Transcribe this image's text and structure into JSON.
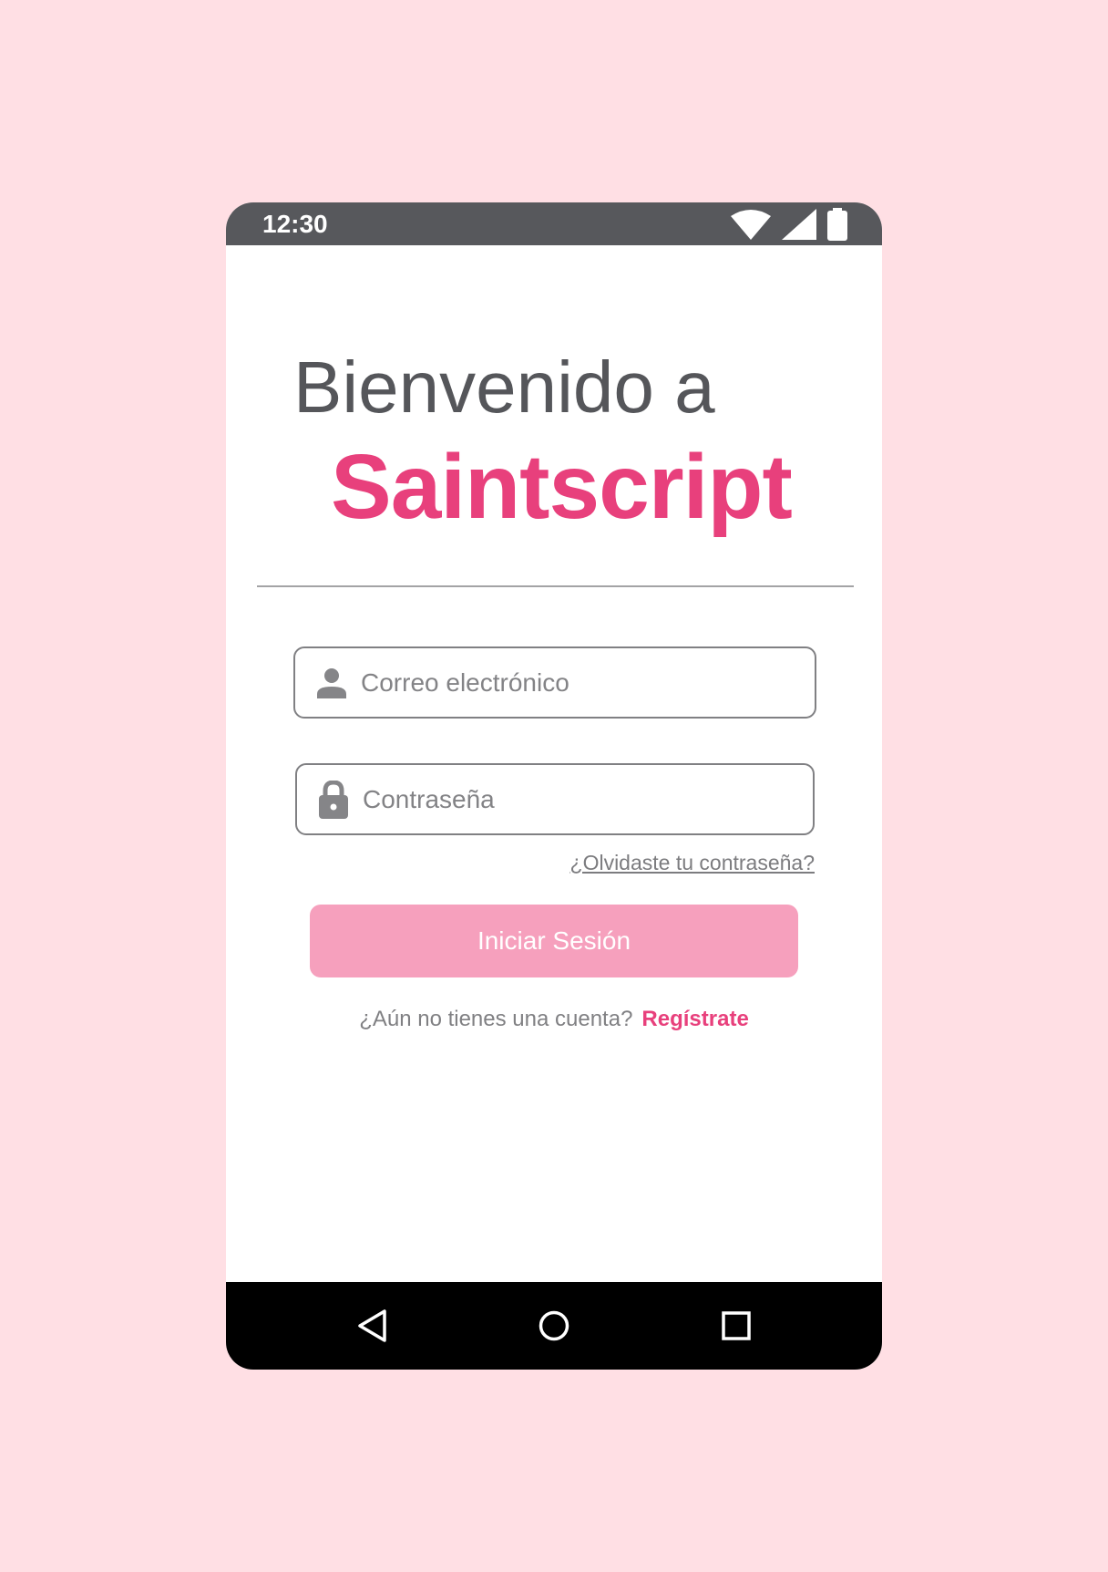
{
  "status_bar": {
    "time": "12:30",
    "icons": [
      "wifi-icon",
      "cell-signal-icon",
      "battery-icon"
    ]
  },
  "welcome": {
    "line1": "Bienvenido a",
    "brand": "Saintscript"
  },
  "form": {
    "email": {
      "placeholder": "Correo electrónico",
      "value": "",
      "icon": "user-icon"
    },
    "password": {
      "placeholder": "Contraseña",
      "value": "",
      "icon": "lock-icon"
    },
    "forgot_password": "¿Olvidaste tu contraseña?",
    "login_button": "Iniciar Sesión"
  },
  "signup": {
    "question": "¿Aún no tienes una cuenta?",
    "link": "Regístrate"
  },
  "nav_bar": {
    "buttons": [
      "back-icon",
      "home-icon",
      "recents-icon"
    ]
  },
  "colors": {
    "background": "#ffdfe4",
    "brand": "#e8407c",
    "button": "#f6a0bd",
    "status_bar": "#57585c",
    "nav_bar": "#000000"
  }
}
